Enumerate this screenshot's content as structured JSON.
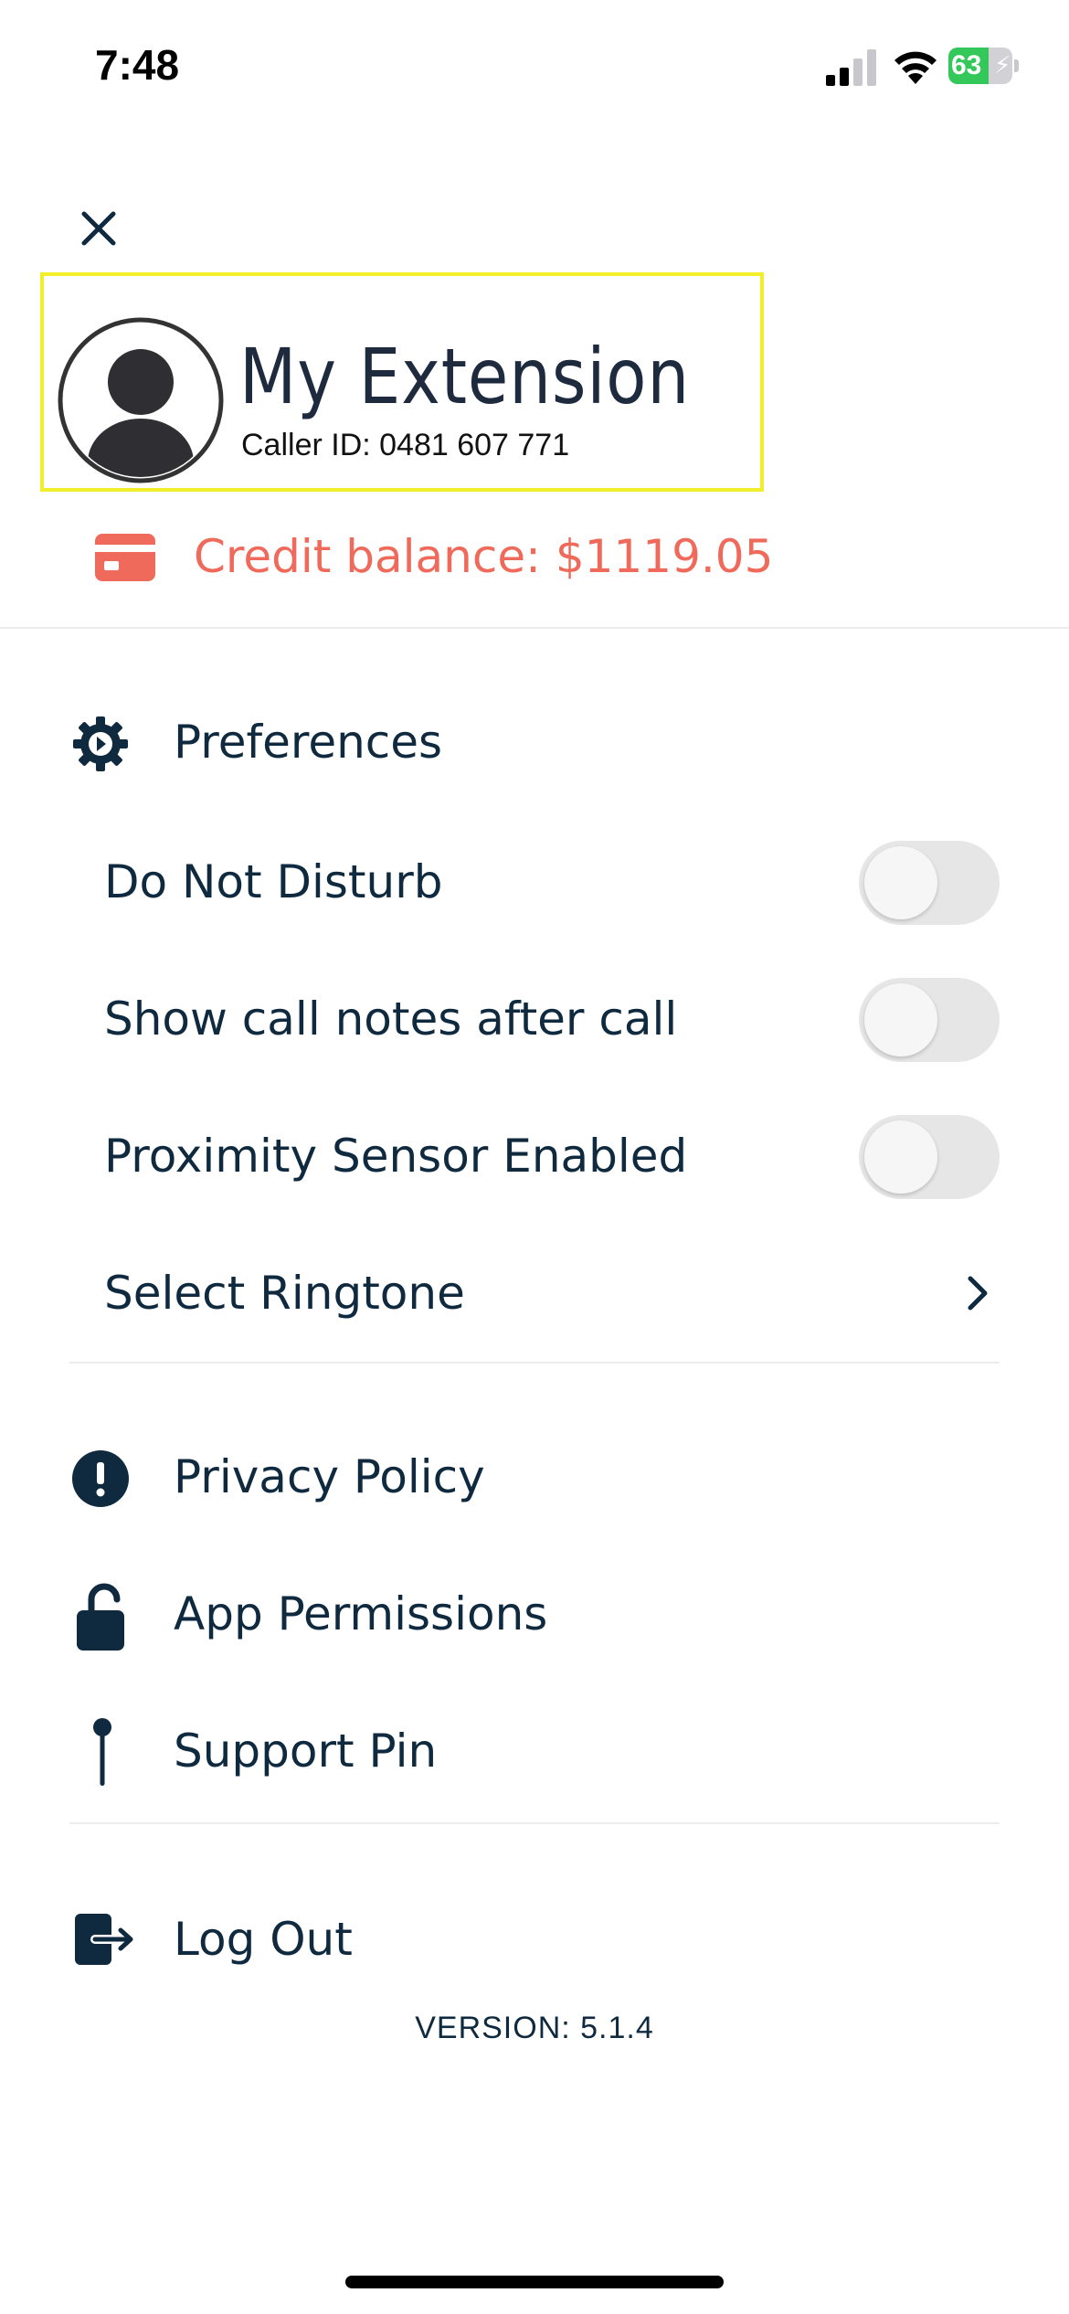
{
  "status_bar": {
    "time": "7:48",
    "battery_level": "63",
    "battery_percent": 63
  },
  "profile": {
    "title": "My Extension",
    "caller_id": "Caller ID: 0481 607 771"
  },
  "credit": {
    "text": "Credit balance: $1119.05"
  },
  "preferences": {
    "heading": "Preferences",
    "items": [
      {
        "label": "Do Not Disturb",
        "enabled": false
      },
      {
        "label": "Show call notes after call",
        "enabled": false
      },
      {
        "label": "Proximity Sensor Enabled",
        "enabled": false
      }
    ],
    "ringtone_label": "Select Ringtone"
  },
  "menu": {
    "privacy": "Privacy Policy",
    "permissions": "App Permissions",
    "support_pin": "Support Pin",
    "logout": "Log Out"
  },
  "version": "VERSION: 5.1.4",
  "colors": {
    "primary": "#0f2a3f",
    "accent": "#ef6a5a",
    "highlight": "#f2ef2a",
    "battery": "#34c759"
  }
}
